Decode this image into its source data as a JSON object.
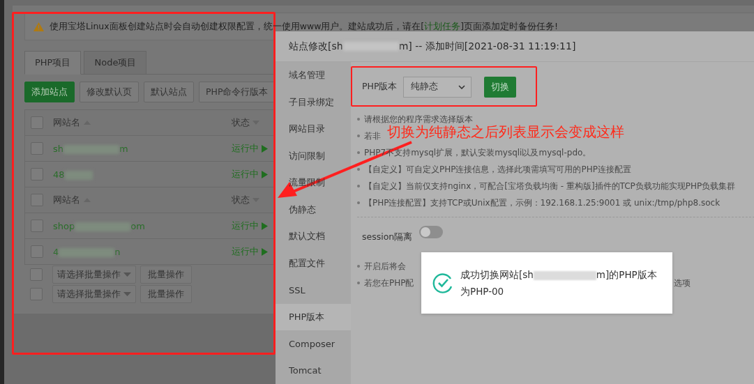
{
  "notice": {
    "text_before": "使用宝塔Linux面板创建站点时会自动创建权限配置，统一使用www用户。建站成功后，请在[",
    "link": "计划任务",
    "text_after": "]页面添加定时备份任务!"
  },
  "tabs": [
    {
      "label": "PHP项目",
      "selected": true
    },
    {
      "label": "Node项目",
      "selected": false
    }
  ],
  "toolbar": [
    {
      "label": "添加站点",
      "kind": "primary"
    },
    {
      "label": "修改默认页",
      "kind": "plain"
    },
    {
      "label": "默认站点",
      "kind": "plain"
    },
    {
      "label": "PHP命令行版本",
      "kind": "plain"
    }
  ],
  "table": {
    "rows": [
      {
        "kind": "header",
        "checked": false,
        "name": "网站名",
        "status": "状态"
      },
      {
        "kind": "site",
        "checked": false,
        "name_start": "sh",
        "name_end": "m",
        "status": "运行中"
      },
      {
        "kind": "site",
        "checked": false,
        "name_start": "48",
        "status": "运行中"
      },
      {
        "kind": "header",
        "checked": false,
        "name": "网站名",
        "status": "状态"
      },
      {
        "kind": "site",
        "checked": false,
        "name_start": "shop",
        "name_end": "om",
        "status": "运行中"
      },
      {
        "kind": "site",
        "checked": false,
        "name_start": "4",
        "name_end": "n",
        "status": "运行中"
      }
    ]
  },
  "batch": [
    {
      "checked": false,
      "placeholder": "请选择批量操作",
      "button": "批量操作"
    },
    {
      "checked": false,
      "placeholder": "请选择批量操作",
      "button": "批量操作"
    }
  ],
  "modal": {
    "title_start": "站点修改[sh",
    "title_end": "m] -- 添加时间[2021-08-31 11:19:11]",
    "menu": [
      {
        "label": "域名管理",
        "selected": false
      },
      {
        "label": "子目录绑定",
        "selected": false
      },
      {
        "label": "网站目录",
        "selected": false
      },
      {
        "label": "访问限制",
        "selected": false
      },
      {
        "label": "流量限制",
        "selected": false
      },
      {
        "label": "伪静态",
        "selected": false
      },
      {
        "label": "默认文档",
        "selected": false
      },
      {
        "label": "配置文件",
        "selected": false
      },
      {
        "label": "SSL",
        "selected": false
      },
      {
        "label": "PHP版本",
        "selected": true
      },
      {
        "label": "Composer",
        "selected": false
      },
      {
        "label": "Tomcat",
        "selected": false
      }
    ],
    "php_label": "PHP版本",
    "php_value": "纯静态",
    "switch_button": "切换",
    "notes": [
      {
        "text": "请根据您的程序需求选择版本"
      },
      {
        "text": "若非"
      },
      {
        "text": "PHP7不支持mysql扩展，默认安装mysqli以及mysql-pdo。"
      },
      {
        "text": "【自定义】可自定义PHP连接信息，选择此项需填写可用的PHP连接配置"
      },
      {
        "text": "【自定义】当前仅支持nginx，可配合[宝塔负载均衡 - 重构版]插件的TCP负载功能实现PHP负载集群"
      },
      {
        "text": "【PHP连接配置】支持TCP或Unix配置，示例：192.168.1.25:9001 或 unix:/tmp/php8.sock"
      }
    ],
    "session": {
      "label": "session隔离",
      "on": false
    },
    "session_notes": [
      {
        "text": "开启后将会"
      },
      {
        "text": "若您在PHP配",
        "tail": "选项"
      }
    ]
  },
  "toast": {
    "message_start": "成功切换网站[sh",
    "message_end": "m]的PHP版本",
    "message_line2": "为PHP-00"
  },
  "annotation": {
    "text": "切换为纯静态之后列表显示会变成这样"
  }
}
